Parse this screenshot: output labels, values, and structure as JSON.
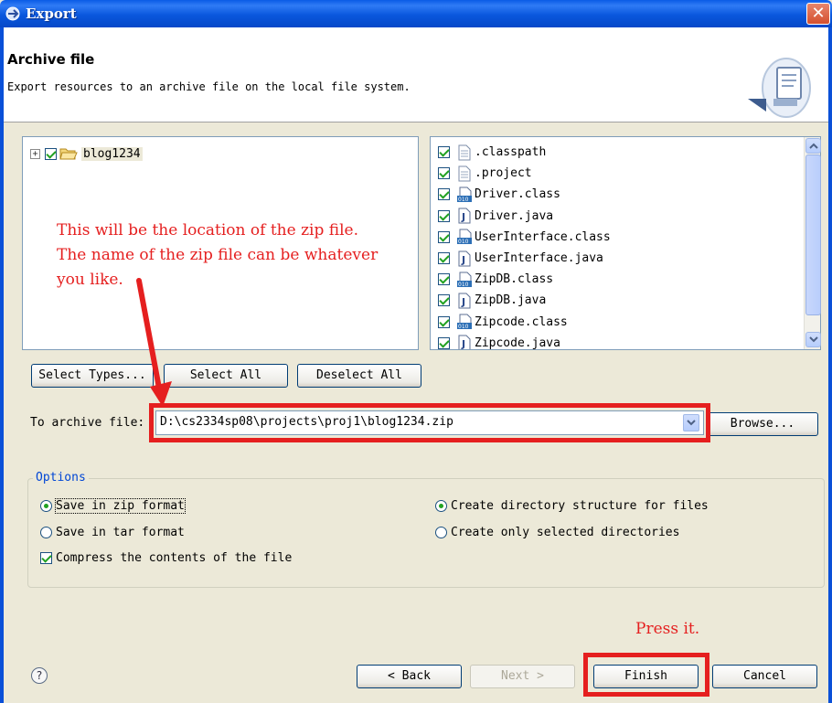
{
  "window": {
    "title": "Export"
  },
  "header": {
    "title": "Archive file",
    "description": "Export resources to an archive file on the local file system."
  },
  "tree": {
    "project": "blog1234",
    "checked": true
  },
  "files": [
    {
      "name": ".classpath",
      "icon": "text-file-icon",
      "checked": true
    },
    {
      "name": ".project",
      "icon": "text-file-icon",
      "checked": true
    },
    {
      "name": "Driver.class",
      "icon": "class-file-icon",
      "checked": true
    },
    {
      "name": "Driver.java",
      "icon": "java-file-icon",
      "checked": true
    },
    {
      "name": "UserInterface.class",
      "icon": "class-file-icon",
      "checked": true
    },
    {
      "name": "UserInterface.java",
      "icon": "java-file-icon",
      "checked": true
    },
    {
      "name": "ZipDB.class",
      "icon": "class-file-icon",
      "checked": true
    },
    {
      "name": "ZipDB.java",
      "icon": "java-file-icon",
      "checked": true
    },
    {
      "name": "Zipcode.class",
      "icon": "class-file-icon",
      "checked": true
    },
    {
      "name": "Zipcode.java",
      "icon": "java-file-icon",
      "checked": true
    }
  ],
  "selection_buttons": {
    "select_types": "Select Types...",
    "select_all": "Select All",
    "deselect_all": "Deselect All"
  },
  "archive": {
    "label": "To archive file:",
    "value": "D:\\cs2334sp08\\projects\\proj1\\blog1234.zip",
    "browse": "Browse..."
  },
  "options": {
    "legend": "Options",
    "zip_format": {
      "label": "Save in zip format",
      "selected": true
    },
    "tar_format": {
      "label": "Save in tar format",
      "selected": false
    },
    "compress": {
      "label": "Compress the contents of the file",
      "checked": true
    },
    "dir_structure": {
      "label": "Create directory structure for files",
      "selected": true
    },
    "selected_dirs": {
      "label": "Create only selected directories",
      "selected": false
    }
  },
  "footer": {
    "back": "< Back",
    "next": "Next >",
    "finish": "Finish",
    "cancel": "Cancel"
  },
  "annotations": {
    "location_line1": "This will be the location of the zip file.",
    "location_line2": "The name of the zip file can be whatever",
    "location_line3": "you like.",
    "press_it": "Press it."
  },
  "colors": {
    "annotation_red": "#e51f1f",
    "titlebar_blue": "#0a5be6",
    "options_legend_blue": "#0046d5"
  }
}
